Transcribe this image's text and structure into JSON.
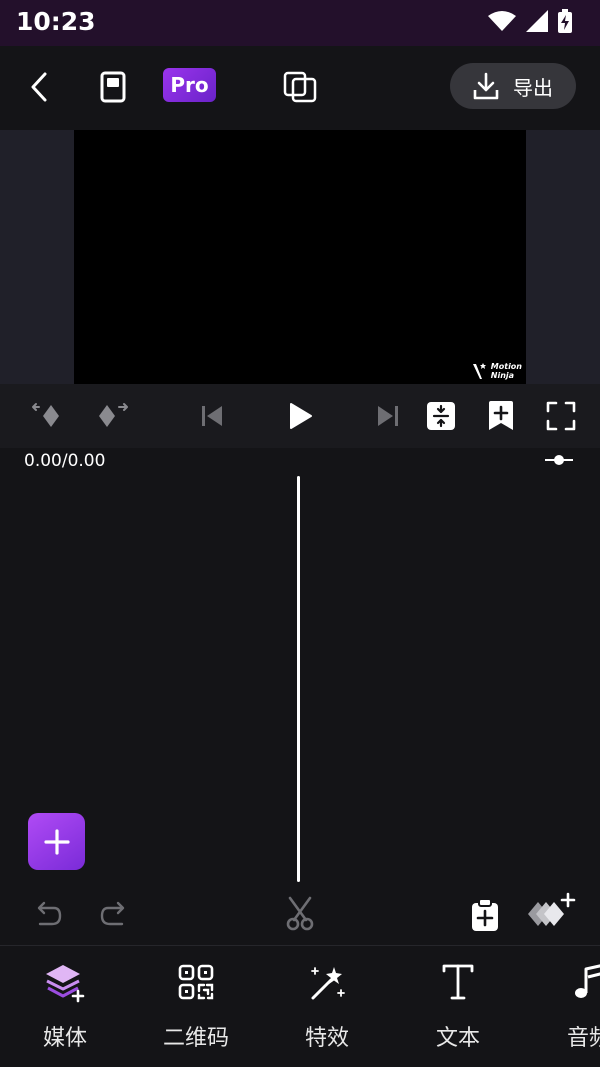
{
  "status_bar": {
    "time": "10:23"
  },
  "top_bar": {
    "pro_label": "Pro",
    "export_label": "导出"
  },
  "preview": {
    "watermark_line1": "Motion",
    "watermark_line2": "Ninja"
  },
  "timeline": {
    "timecode": "0.00/0.00"
  },
  "bottom_tabs": [
    {
      "label": "媒体",
      "icon": "layers-add-icon"
    },
    {
      "label": "二维码",
      "icon": "qr-code-icon"
    },
    {
      "label": "特效",
      "icon": "magic-wand-icon"
    },
    {
      "label": "文本",
      "icon": "text-icon"
    },
    {
      "label": "音频",
      "icon": "music-note-icon"
    }
  ],
  "colors": {
    "accent": "#8b2fe6",
    "status_bar": "#23102b",
    "background": "#141417"
  }
}
